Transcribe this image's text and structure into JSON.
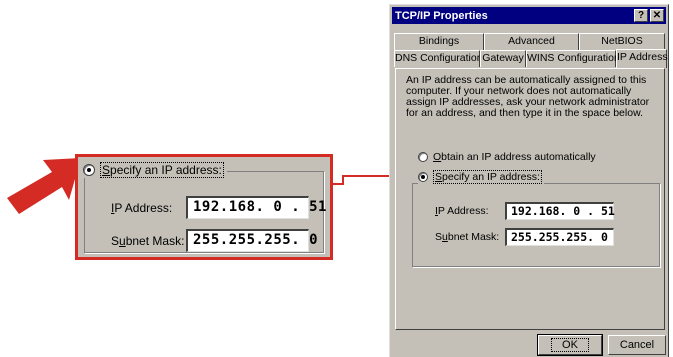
{
  "callout": {
    "option_label_mnemonic": "S",
    "option_label_rest": "pecify an IP address:",
    "ip_label_mnemonic": "I",
    "ip_label_rest": "P Address:",
    "ip_value": "192.168. 0 . 51",
    "mask_label_pre": "S",
    "mask_label_mnemonic": "u",
    "mask_label_rest": "bnet Mask:",
    "mask_value": "255.255.255. 0"
  },
  "dialog": {
    "title": "TCP/IP Properties",
    "help_button": "?",
    "close_button": "✕",
    "tabs_back": [
      "Bindings",
      "Advanced",
      "NetBIOS"
    ],
    "tabs_front": [
      "DNS Configuration",
      "Gateway",
      "WINS Configuration",
      "IP Address"
    ],
    "active_tab": "IP Address",
    "description": "An IP address can be automatically assigned to this computer. If your network does not automatically assign IP addresses, ask your network administrator for an address, and then type it in the space below.",
    "obtain_mnemonic": "O",
    "obtain_rest": "btain an IP address automatically",
    "specify_mnemonic": "S",
    "specify_rest": "pecify an IP address:",
    "ip_label_mnemonic": "I",
    "ip_label_rest": "P Address:",
    "ip_value": "192.168. 0 . 51",
    "mask_label_pre": "S",
    "mask_label_mnemonic": "u",
    "mask_label_rest": "bnet Mask:",
    "mask_value": "255.255.255. 0",
    "ok_label": "OK",
    "cancel_label": "Cancel"
  },
  "colors": {
    "highlight_red": "#d42b25",
    "dialog_face": "#c4c0b8",
    "titlebar_blue": "#000080"
  },
  "icons": {
    "pointer": "red-arrow-icon",
    "connector": "connector-arrow-icon"
  }
}
